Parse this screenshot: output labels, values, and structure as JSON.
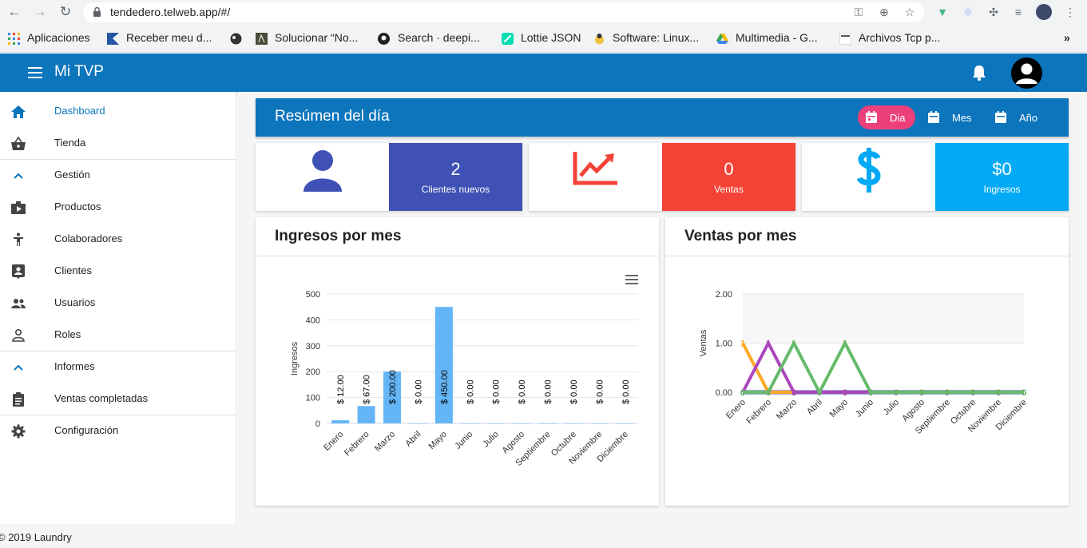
{
  "browser": {
    "url": "tendedero.telweb.app/#/",
    "bookmarks": [
      "Aplicaciones",
      "Receber meu d...",
      "Solucionar “No...",
      "Search · deepi...",
      "Lottie JSON",
      "Software: Linux...",
      "Multimedia - G...",
      "Archivos Tcp p..."
    ]
  },
  "app": {
    "title": "Mi TVP"
  },
  "sidebar": {
    "items": [
      {
        "label": "Dashboard",
        "icon": "home-icon"
      },
      {
        "label": "Tienda",
        "icon": "basket-icon"
      },
      {
        "label": "Gestión",
        "icon": "chevron-up-icon"
      },
      {
        "label": "Productos",
        "icon": "video-box-icon"
      },
      {
        "label": "Colaboradores",
        "icon": "person-icon"
      },
      {
        "label": "Clientes",
        "icon": "contact-card-icon"
      },
      {
        "label": "Usuarios",
        "icon": "users-icon"
      },
      {
        "label": "Roles",
        "icon": "user-outline-icon"
      },
      {
        "label": "Informes",
        "icon": "chevron-up-icon"
      },
      {
        "label": "Ventas completadas",
        "icon": "clipboard-icon"
      },
      {
        "label": "Configuración",
        "icon": "gear-icon"
      }
    ]
  },
  "summary": {
    "title": "Resúmen del día",
    "periods": [
      "Dia",
      "Mes",
      "Año"
    ],
    "cards": [
      {
        "value": "2",
        "label": "Clientes nuevos",
        "color": "#3f51b5"
      },
      {
        "value": "0",
        "label": "Ventas",
        "color": "#f44336"
      },
      {
        "value": "$0",
        "label": "Ingresos",
        "color": "#03a9f4"
      }
    ]
  },
  "panels": {
    "ingresos_title": "Ingresos por mes",
    "ventas_title": "Ventas por mes"
  },
  "chart_data": [
    {
      "type": "bar",
      "title": "Ingresos por mes",
      "ylabel": "Ingresos",
      "ylim": [
        0,
        500
      ],
      "yticks": [
        0,
        100,
        200,
        300,
        400,
        500
      ],
      "categories": [
        "Enero",
        "Febrero",
        "Marzo",
        "Abril",
        "Mayo",
        "Junio",
        "Julio",
        "Agosto",
        "Septiembre",
        "Octubre",
        "Noviembre",
        "Diciembre"
      ],
      "values": [
        12,
        67,
        200,
        0,
        450,
        0,
        0,
        0,
        0,
        0,
        0,
        0
      ],
      "data_labels": [
        "$ 12.00",
        "$ 67.00",
        "$ 200.00",
        "$ 0.00",
        "$ 450.00",
        "$ 0.00",
        "$ 0.00",
        "$ 0.00",
        "$ 0.00",
        "$ 0.00",
        "$ 0.00",
        "$ 0.00"
      ],
      "color": "#64b5f6"
    },
    {
      "type": "line",
      "title": "Ventas por mes",
      "ylabel": "Ventas",
      "ylim": [
        0,
        2
      ],
      "yticks": [
        "0.00",
        "1.00",
        "2.00"
      ],
      "categories": [
        "Enero",
        "Febrero",
        "Marzo",
        "Abril",
        "Mayo",
        "Junio",
        "Julio",
        "Agosto",
        "Septiembre",
        "Octubre",
        "Noviembre",
        "Diciembre"
      ],
      "series": [
        {
          "values": [
            1,
            0,
            0,
            0,
            0,
            0,
            0,
            0,
            0,
            0,
            0,
            0
          ],
          "color": "#ffa726"
        },
        {
          "values": [
            0,
            1,
            0,
            0,
            0,
            0,
            0,
            0,
            0,
            0,
            0,
            0
          ],
          "color": "#ab47bc"
        },
        {
          "values": [
            0,
            0,
            1,
            0,
            1,
            0,
            0,
            0,
            0,
            0,
            0,
            0
          ],
          "color": "#66bb6a"
        },
        {
          "values": [
            0,
            0,
            0,
            0,
            0,
            0,
            0,
            0,
            0,
            0,
            0,
            0
          ],
          "color": "#3f51b5"
        }
      ]
    }
  ],
  "footer": {
    "text": "© 2019 Laundry"
  }
}
